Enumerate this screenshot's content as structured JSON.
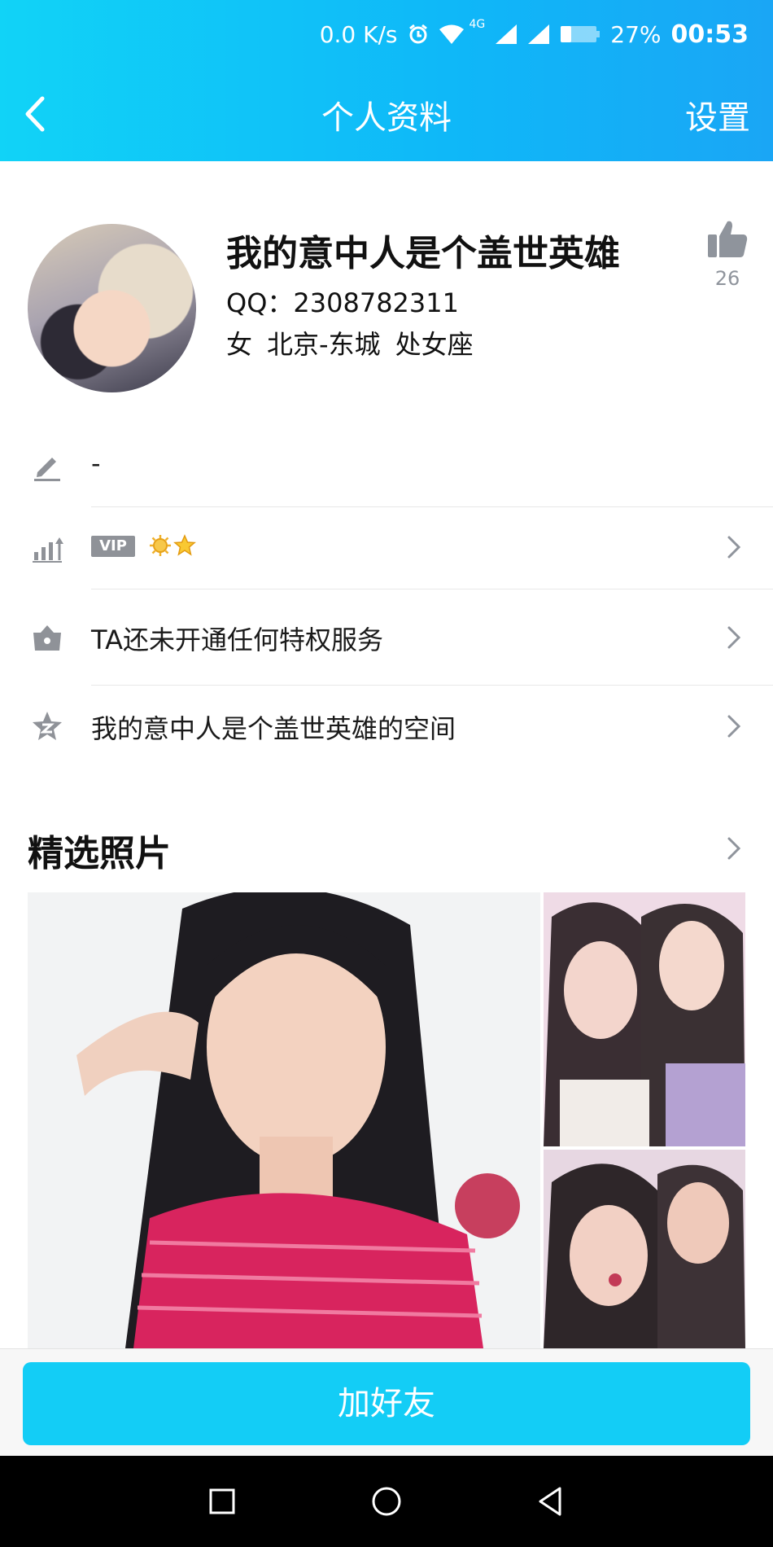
{
  "status_bar": {
    "network_speed": "0.0 K/s",
    "network_type": "4G",
    "battery_percent": "27%",
    "time": "00:53"
  },
  "nav": {
    "title": "个人资料",
    "settings_label": "设置"
  },
  "profile": {
    "nickname": "我的意中人是个盖世英雄",
    "qq_label": "QQ：",
    "qq_number": "2308782311",
    "gender": "女",
    "location": "北京-东城",
    "zodiac": "处女座",
    "like_count": "26"
  },
  "rows": {
    "signature": "-",
    "vip_badge": "VIP",
    "privilege": "TA还未开通任何特权服务",
    "space": "我的意中人是个盖世英雄的空间"
  },
  "photos": {
    "section_title": "精选照片"
  },
  "actions": {
    "add_friend": "加好友"
  },
  "colors": {
    "header_gradient_start": "#11d3f7",
    "header_gradient_end": "#1aa6f5",
    "primary_button": "#13cdf6",
    "icon_gray": "#8f9298"
  }
}
